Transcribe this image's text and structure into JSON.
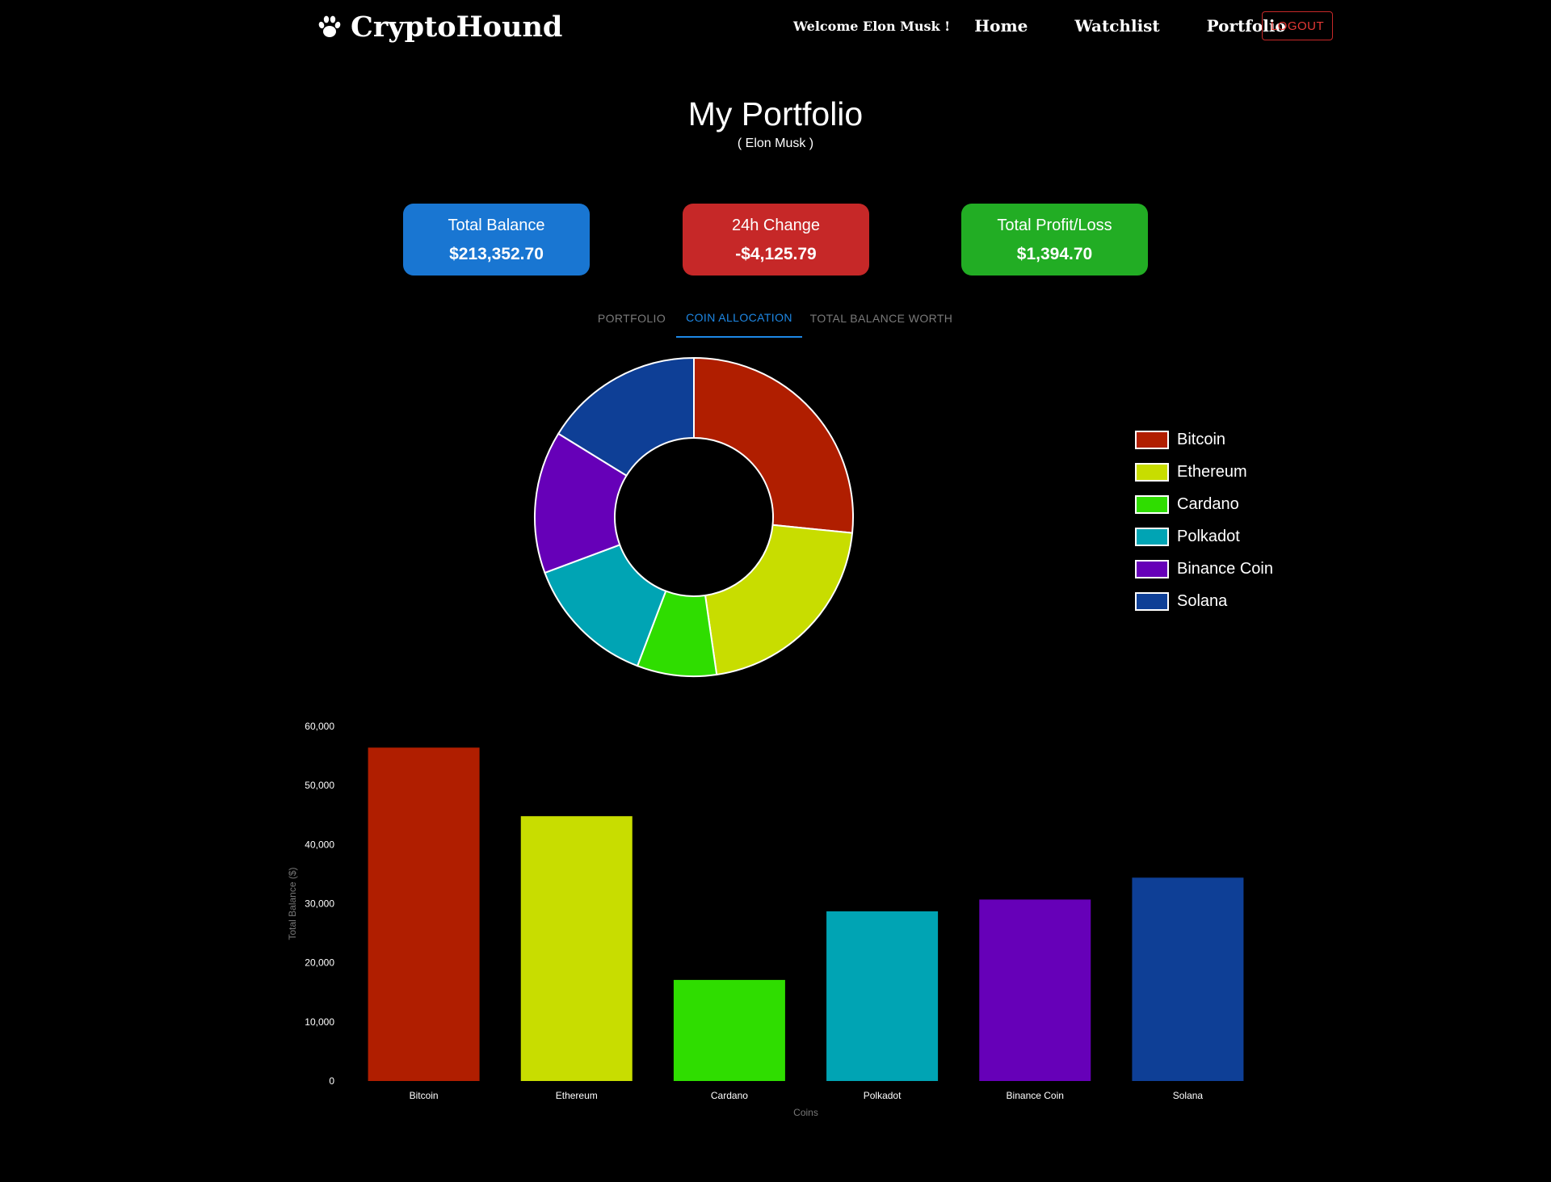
{
  "nav": {
    "brand": "CryptoHound",
    "welcome": "Welcome Elon Musk !",
    "links": [
      "Home",
      "Watchlist",
      "Portfolio"
    ],
    "logout": "LOGOUT"
  },
  "header": {
    "title": "My Portfolio",
    "subtitle": "( Elon Musk )"
  },
  "stats": [
    {
      "label": "Total Balance",
      "value": "$213,352.70",
      "color": "#1976d2"
    },
    {
      "label": "24h Change",
      "value": "-$4,125.79",
      "color": "#c62828"
    },
    {
      "label": "Total Profit/Loss",
      "value": "$1,394.70",
      "color": "#22ad24"
    }
  ],
  "tabs": [
    {
      "label": "PORTFOLIO",
      "active": false
    },
    {
      "label": "COIN ALLOCATION",
      "active": true
    },
    {
      "label": "TOTAL BALANCE WORTH",
      "active": false
    }
  ],
  "chart_data": [
    {
      "type": "pie",
      "categories": [
        "Bitcoin",
        "Ethereum",
        "Cardano",
        "Polkadot",
        "Binance Coin",
        "Solana"
      ],
      "values": [
        56400,
        44800,
        17100,
        28700,
        30700,
        34400
      ],
      "colors": [
        "#b01e00",
        "#c8dd00",
        "#2fdd00",
        "#00a4b4",
        "#6600b8",
        "#0e3f96"
      ],
      "legend": "right"
    },
    {
      "type": "bar",
      "categories": [
        "Bitcoin",
        "Ethereum",
        "Cardano",
        "Polkadot",
        "Binance Coin",
        "Solana"
      ],
      "values": [
        56400,
        44800,
        17100,
        28700,
        30700,
        34400
      ],
      "colors": [
        "#b01e00",
        "#c8dd00",
        "#2fdd00",
        "#00a4b4",
        "#6600b8",
        "#0e3f96"
      ],
      "xlabel": "Coins",
      "ylabel": "Total Balance ($)",
      "ylim": [
        0,
        60000
      ],
      "yticks": [
        "0",
        "10,000",
        "20,000",
        "30,000",
        "40,000",
        "50,000",
        "60,000"
      ],
      "grid": false
    }
  ]
}
